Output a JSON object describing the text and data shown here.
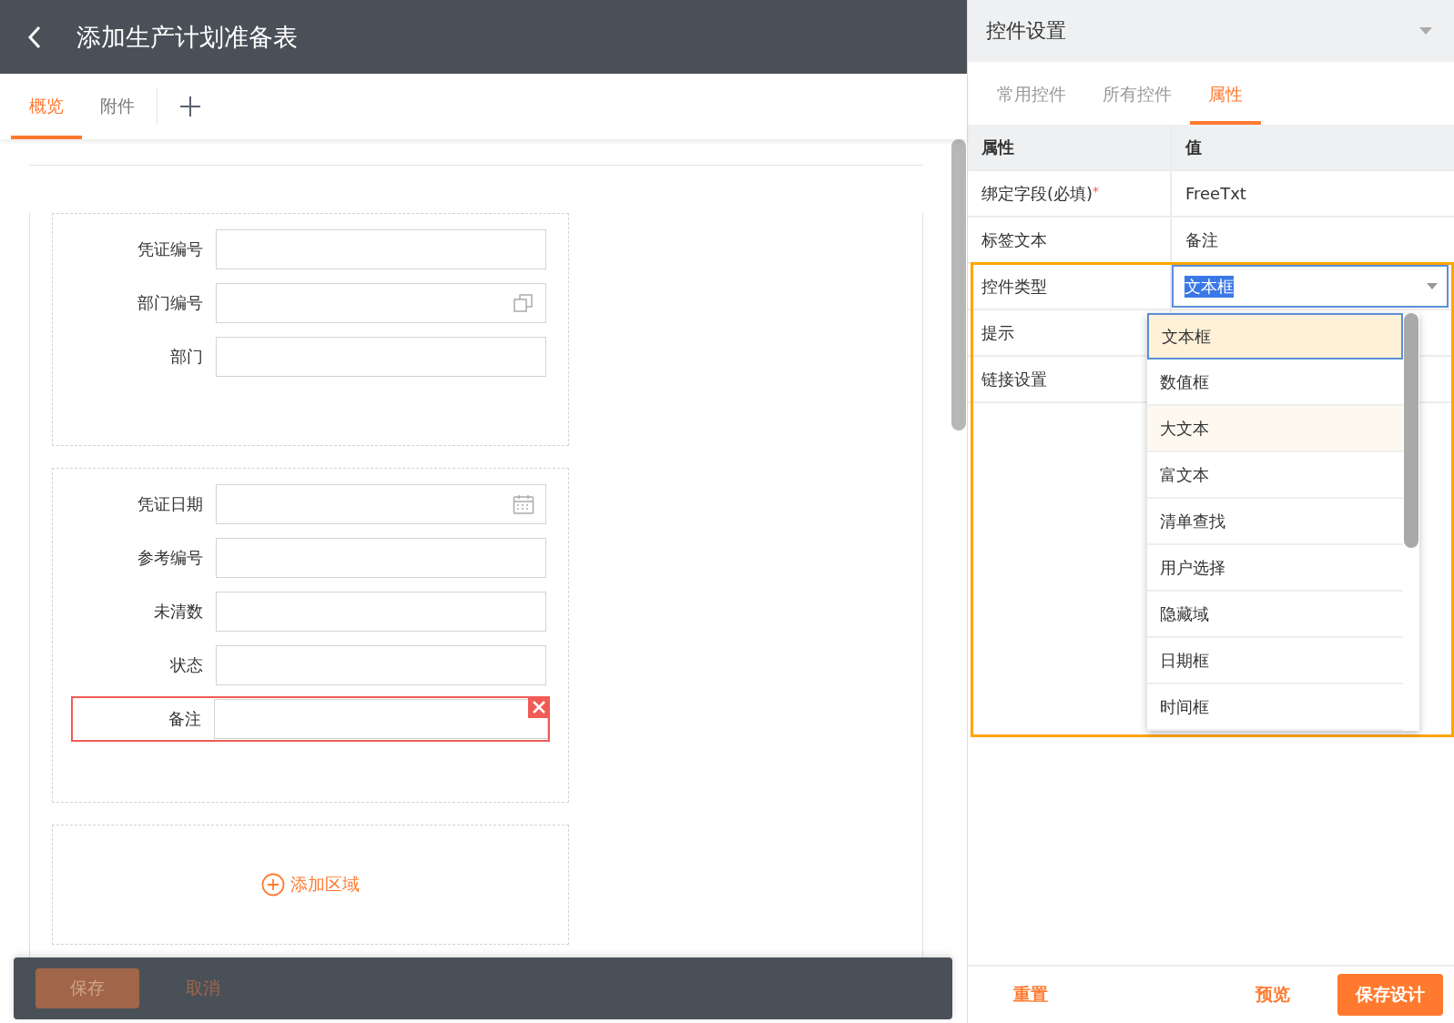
{
  "header": {
    "title": "添加生产计划准备表"
  },
  "tabs": [
    {
      "label": "概览",
      "selected": true
    },
    {
      "label": "附件",
      "selected": false
    }
  ],
  "sections": [
    {
      "kind": "fields",
      "fields": [
        {
          "label": "凭证编号",
          "kind": "plain",
          "selected": false
        },
        {
          "label": "部门编号",
          "kind": "lookup",
          "selected": false
        },
        {
          "label": "部门",
          "kind": "plain",
          "selected": false
        }
      ]
    },
    {
      "kind": "fields",
      "fields": [
        {
          "label": "凭证日期",
          "kind": "date",
          "selected": false
        },
        {
          "label": "参考编号",
          "kind": "plain",
          "selected": false
        },
        {
          "label": "未清数",
          "kind": "plain",
          "selected": false
        },
        {
          "label": "状态",
          "kind": "plain",
          "selected": false
        },
        {
          "label": "备注",
          "kind": "plain",
          "selected": true
        }
      ]
    },
    {
      "kind": "add",
      "label": "添加区域"
    }
  ],
  "footer": {
    "buttons": [
      {
        "label": "保存",
        "kind": "primary",
        "disabled": true
      },
      {
        "label": "取消",
        "kind": "link",
        "disabled": true
      }
    ]
  },
  "settings": {
    "title": "控件设置",
    "tabs": [
      {
        "label": "常用控件",
        "selected": false
      },
      {
        "label": "所有控件",
        "selected": false
      },
      {
        "label": "属性",
        "selected": true
      }
    ],
    "columns": [
      "属性",
      "值"
    ],
    "rows": [
      {
        "property": "绑定字段(必填)",
        "required_mark": "*",
        "kind": "text",
        "value": "FreeTxt"
      },
      {
        "property": "标签文本",
        "kind": "text",
        "value": "备注"
      },
      {
        "property": "控件类型",
        "kind": "select",
        "value": "文本框"
      },
      {
        "property": "提示",
        "kind": "text"
      },
      {
        "property": "链接设置",
        "kind": "text"
      }
    ],
    "dropdown": [
      {
        "label": "文本框",
        "selected": true,
        "hovered": false
      },
      {
        "label": "数值框",
        "selected": false,
        "hovered": false
      },
      {
        "label": "大文本",
        "selected": false,
        "hovered": true
      },
      {
        "label": "富文本",
        "selected": false,
        "hovered": false
      },
      {
        "label": "清单查找",
        "selected": false,
        "hovered": false
      },
      {
        "label": "用户选择",
        "selected": false,
        "hovered": false
      },
      {
        "label": "隐藏域",
        "selected": false,
        "hovered": false
      },
      {
        "label": "日期框",
        "selected": false,
        "hovered": false
      },
      {
        "label": "时间框",
        "selected": false,
        "hovered": false
      }
    ],
    "buttons": [
      {
        "label": "重置",
        "kind": "link"
      },
      {
        "label": "预览",
        "kind": "link"
      },
      {
        "label": "保存设计",
        "kind": "primary"
      }
    ]
  }
}
